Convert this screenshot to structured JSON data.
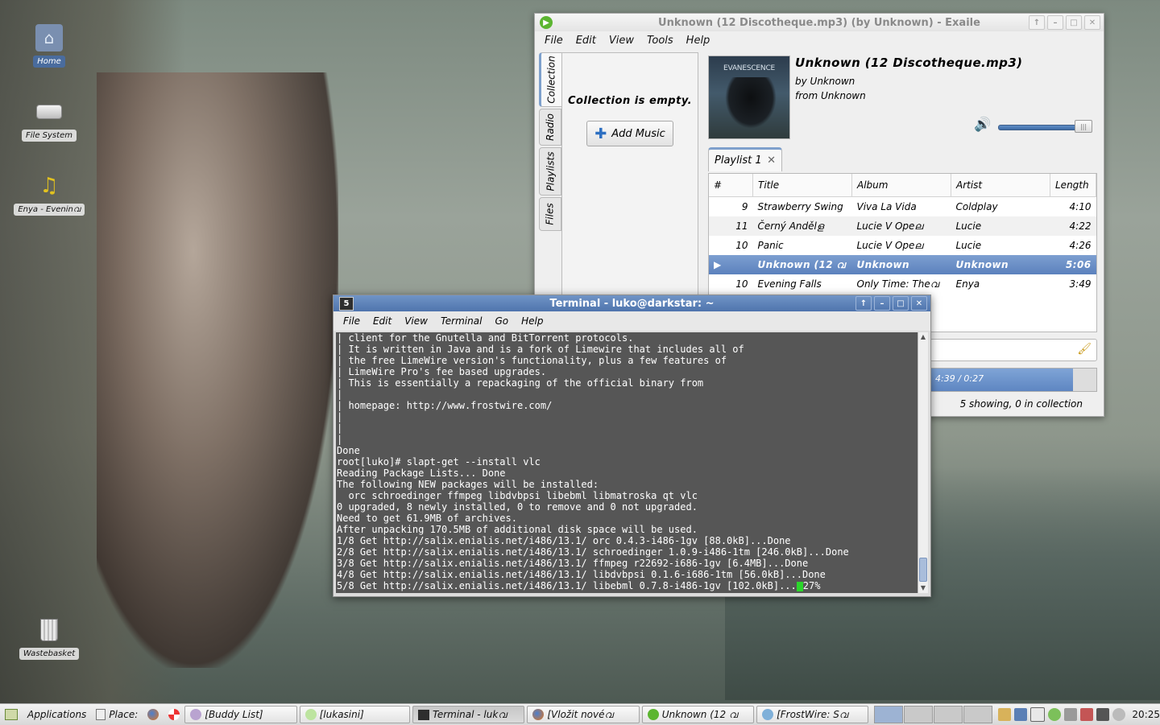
{
  "desktop": {
    "icons": [
      {
        "label": "Home",
        "icon": "home-folder-icon"
      },
      {
        "label": "File System",
        "icon": "drive-icon"
      },
      {
        "label": "Enya - Eveninവ",
        "icon": "music-note-icon"
      },
      {
        "label": "Wastebasket",
        "icon": "trash-icon"
      }
    ]
  },
  "exaile": {
    "title": "Unknown (12 Discotheque.mp3) (by Unknown) - Exaile",
    "menu": [
      "File",
      "Edit",
      "View",
      "Tools",
      "Help"
    ],
    "side_tabs": [
      "Collection",
      "Radio",
      "Playlists",
      "Files"
    ],
    "collection_empty": "Collection is empty.",
    "add_music": "Add Music",
    "now_playing": {
      "title": "Unknown (12 Discotheque.mp3)",
      "by": "by Unknown",
      "from": "from Unknown",
      "cover_text": "EVANESCENCE"
    },
    "volume_level": 0.95,
    "playlist_tab": "Playlist 1",
    "columns": [
      "#",
      "Title",
      "Album",
      "Artist",
      "Length"
    ],
    "rows": [
      {
        "num": "9",
        "title": "Strawberry Swing",
        "album": "Viva La Vida",
        "artist": "Coldplay",
        "length": "4:10"
      },
      {
        "num": "11",
        "title": "Černý Andělള",
        "album": "Lucie V Opeല",
        "artist": "Lucie",
        "length": "4:22"
      },
      {
        "num": "10",
        "title": "Panic",
        "album": "Lucie V Opeല",
        "artist": "Lucie",
        "length": "4:26"
      },
      {
        "num": "",
        "title": "Unknown (12 വ",
        "album": "Unknown",
        "artist": "Unknown",
        "length": "5:06"
      },
      {
        "num": "10",
        "title": "Evening Falls",
        "album": "Only Time: Theവ",
        "artist": "Enya",
        "length": "3:49"
      }
    ],
    "progress_text": "4:39 / 0:27",
    "progress_fraction": 0.86,
    "status": "5 showing, 0 in collection"
  },
  "terminal": {
    "title": "Terminal - luko@darkstar: ~",
    "menu": [
      "File",
      "Edit",
      "View",
      "Terminal",
      "Go",
      "Help"
    ],
    "lines": [
      "| client for the Gnutella and BitTorrent protocols.",
      "| It is written in Java and is a fork of Limewire that includes all of",
      "| the free LimeWire version's functionality, plus a few features of",
      "| LimeWire Pro's fee based upgrades.",
      "| This is essentially a repackaging of the official binary from",
      "|",
      "| homepage: http://www.frostwire.com/",
      "|",
      "|",
      "|",
      "Done",
      "root[luko]# slapt-get --install vlc",
      "Reading Package Lists... Done",
      "The following NEW packages will be installed:",
      "  orc schroedinger ffmpeg libdvbpsi libebml libmatroska qt vlc",
      "0 upgraded, 8 newly installed, 0 to remove and 0 not upgraded.",
      "Need to get 61.9MB of archives.",
      "After unpacking 170.5MB of additional disk space will be used.",
      "1/8 Get http://salix.enialis.net/i486/13.1/ orc 0.4.3-i486-1gv [88.0kB]...Done",
      "2/8 Get http://salix.enialis.net/i486/13.1/ schroedinger 1.0.9-i486-1tm [246.0kB]...Done",
      "3/8 Get http://salix.enialis.net/i486/13.1/ ffmpeg r22692-i686-1gv [6.4MB]...Done",
      "4/8 Get http://salix.enialis.net/i486/13.1/ libdvbpsi 0.1.6-i686-1tm [56.0kB]...Done",
      "5/8 Get http://salix.enialis.net/i486/13.1/ libebml 0.7.8-i486-1gv [102.0kB]..."
    ],
    "last_suffix": "27%"
  },
  "taskbar": {
    "applications": "Applications",
    "places": "Place:",
    "tasks": [
      {
        "label": "[Buddy List]",
        "icon": "pidgin-icon"
      },
      {
        "label": "[lukasini]",
        "icon": "chat-icon"
      },
      {
        "label": "Terminal - lukവ",
        "icon": "terminal-icon"
      },
      {
        "label": "[Vložit novéവ",
        "icon": "firefox-icon"
      },
      {
        "label": "Unknown (12 വ",
        "icon": "exaile-icon"
      },
      {
        "label": "[FrostWire: Sവ",
        "icon": "frostwire-icon"
      }
    ],
    "clock": "20:25"
  }
}
